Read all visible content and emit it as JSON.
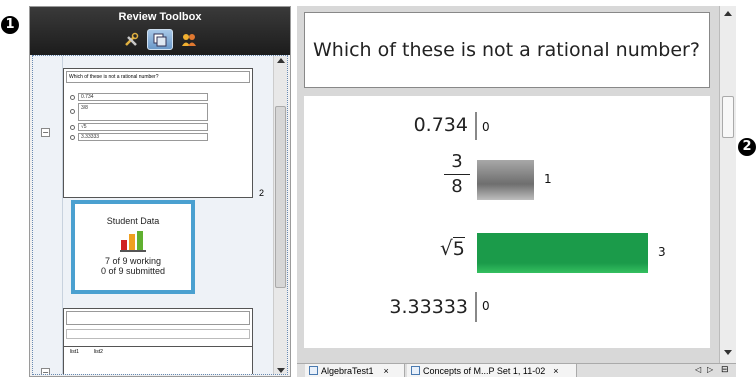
{
  "callouts": {
    "left": "1",
    "right": "2"
  },
  "toolbox": {
    "title": "Review Toolbox",
    "tools": [
      {
        "icon": "tools-icon"
      },
      {
        "icon": "page-sorter-icon",
        "active": true
      },
      {
        "icon": "class-icon"
      }
    ]
  },
  "question_thumb": {
    "prompt": "Which of these is not a rational number?",
    "options": [
      "0.734",
      "3/8",
      "√5",
      "3.33333"
    ],
    "page_number": "2"
  },
  "student_data": {
    "title": "Student Data",
    "working": "7 of 9 working",
    "submitted": "0 of 9 submitted"
  },
  "list_thumb": {
    "col1": "list1",
    "col2": "list2"
  },
  "question": {
    "text": "Which of these is not a rational number?"
  },
  "chart_data": {
    "type": "bar",
    "orientation": "horizontal",
    "categories": [
      "0.734",
      "3/8",
      "√5",
      "3.33333"
    ],
    "values": [
      0,
      1,
      3,
      0
    ],
    "bar_colors": [
      "#888888",
      "#8a8a8a",
      "#1a9e4a",
      "#888888"
    ],
    "xlim": [
      0,
      3
    ],
    "grid": false
  },
  "tabs": [
    {
      "label": "AlgebraTest1",
      "close": "×"
    },
    {
      "label": "Concepts of M...P Set 1, 11-02",
      "close": "×"
    }
  ],
  "tab_nav": {
    "prev": "◁",
    "next": "▷",
    "menu": "⊟"
  }
}
